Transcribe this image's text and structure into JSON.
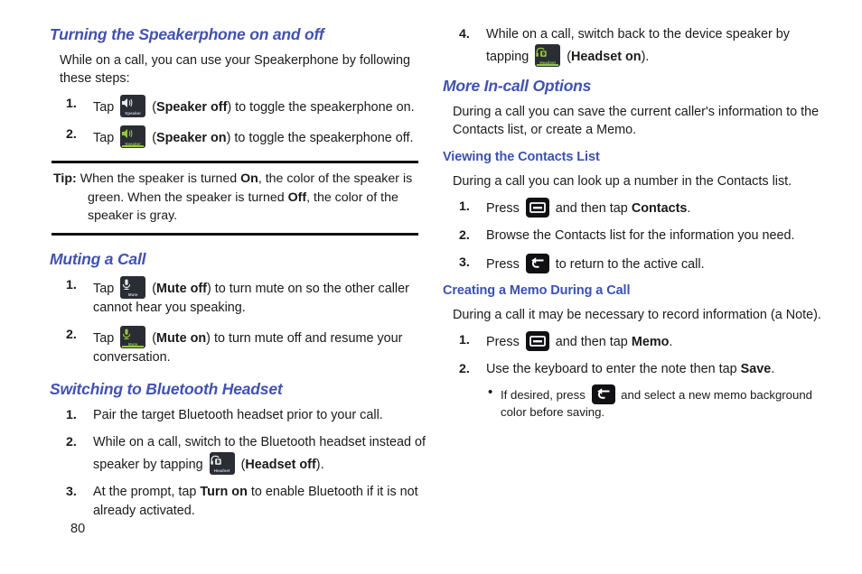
{
  "page": {
    "number": "80"
  },
  "colors": {
    "heading_blue": "#4152b0",
    "subheading_blue": "#3a52b2",
    "icon_dark": "#2b2d35",
    "icon_green": "#93c83e",
    "key_black": "#111114",
    "rule_black": "#111111"
  },
  "left_column": {
    "section1": {
      "title": "Turning the Speakerphone on and off",
      "intro": "While on a call, you can use your Speakerphone by following these steps:",
      "steps": [
        {
          "num": "1.",
          "pre": "Tap",
          "icon": "speaker-off-icon",
          "icon_caption": "Speaker",
          "bold": "Speaker off",
          "post_open": "(",
          "post": ") to toggle the speakerphone on."
        },
        {
          "num": "2.",
          "pre": "Tap",
          "icon": "speaker-on-icon",
          "icon_caption": "Speaker",
          "bold": "Speaker on",
          "post_open": "(",
          "post": ") to toggle the speakerphone off."
        }
      ]
    },
    "tip": {
      "label": "Tip:",
      "line1_a": " When the speaker is turned ",
      "line1_b": "On",
      "line1_c": ", the color of the speaker is",
      "line2_a": "green. When the speaker is turned ",
      "line2_b": "Off",
      "line2_c": ", the color of the",
      "line3": "speaker is gray."
    },
    "section2": {
      "title": "Muting a Call",
      "steps": [
        {
          "num": "1.",
          "pre": "Tap",
          "icon": "mute-off-icon",
          "icon_caption": "Mute",
          "bold": "Mute off",
          "post": ") to turn mute on so the other caller cannot hear you speaking."
        },
        {
          "num": "2.",
          "pre": "Tap",
          "icon": "mute-on-icon",
          "icon_caption": "Mute",
          "bold": "Mute on",
          "post": ") to turn mute off and resume your conversation."
        }
      ]
    },
    "section3": {
      "title": "Switching to Bluetooth Headset",
      "step1": {
        "num": "1.",
        "text": "Pair the target Bluetooth headset prior to your call."
      },
      "step2": {
        "num": "2.",
        "pre": "While on a call, switch to the Bluetooth headset instead of speaker by tapping",
        "icon": "headset-off-icon",
        "icon_caption": "Headset",
        "bold": "Headset off",
        "post": ")."
      },
      "step3": {
        "num": "3.",
        "pre": "At the prompt, tap ",
        "bold": "Turn on",
        "post": " to enable Bluetooth if it is not already activated."
      }
    }
  },
  "right_column": {
    "step4": {
      "num": "4.",
      "pre": "While on a call, switch back to the device speaker by tapping",
      "icon": "headset-on-icon",
      "icon_caption": "Headset",
      "bold": "Headset on",
      "post": ")."
    },
    "section1": {
      "title": "More In-call Options",
      "intro": "During a call you can save the current caller's information to the Contacts list, or create a Memo."
    },
    "section2": {
      "title": "Viewing the Contacts List",
      "intro": "During a call you can look up a number in the Contacts list.",
      "steps": [
        {
          "num": "1.",
          "pre": "Press",
          "icon": "menu-key-icon",
          "mid": " and then tap ",
          "bold": "Contacts",
          "post": "."
        },
        {
          "num": "2.",
          "text": "Browse the Contacts list for the information you need."
        },
        {
          "num": "3.",
          "pre": "Press",
          "icon": "back-key-icon",
          "post": " to return to the active call."
        }
      ]
    },
    "section3": {
      "title": "Creating a Memo During a Call",
      "intro": "During a call it may be necessary to record information (a Note).",
      "step1": {
        "num": "1.",
        "pre": "Press",
        "icon": "menu-key-icon",
        "mid": " and then tap ",
        "bold": "Memo",
        "post": "."
      },
      "step2": {
        "num": "2.",
        "pre": "Use the keyboard to enter the note then tap ",
        "bold": "Save",
        "post": "."
      },
      "bullet": {
        "dot": "•",
        "pre": "If desired, press",
        "icon": "back-key-icon",
        "post": " and select a new memo background color before saving."
      }
    }
  }
}
